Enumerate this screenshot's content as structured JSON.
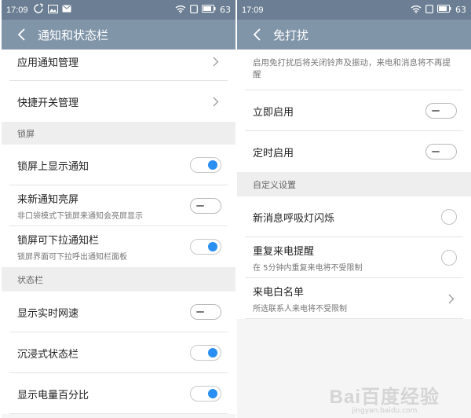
{
  "left": {
    "status_time": "17:09",
    "battery": "63",
    "title": "通知和状态栏",
    "rows_top": [
      {
        "label": "应用通知管理"
      },
      {
        "label": "快捷开关管理"
      }
    ],
    "section_lock": "锁屏",
    "lock_rows": [
      {
        "label": "锁屏上显示通知",
        "sub": "",
        "on": true
      },
      {
        "label": "来新通知亮屏",
        "sub": "非口袋模式下锁屏来通知会亮屏显示",
        "on": false
      },
      {
        "label": "锁屏可下拉通知栏",
        "sub": "锁屏界面可下拉呼出通知栏面板",
        "on": true
      }
    ],
    "section_status": "状态栏",
    "status_rows": [
      {
        "label": "显示实时网速",
        "on": false
      },
      {
        "label": "沉浸式状态栏",
        "on": true
      },
      {
        "label": "显示电量百分比",
        "on": true
      }
    ]
  },
  "right": {
    "status_time": "17:09",
    "battery": "63",
    "title": "免打扰",
    "description": "启用免打扰后将关闭铃声及振动，来电和消息将不再提醒",
    "rows": [
      {
        "label": "立即启用",
        "on": false
      },
      {
        "label": "定时启用",
        "on": false
      }
    ],
    "section_custom": "自定义设置",
    "custom_rows": [
      {
        "label": "新消息呼吸灯闪烁",
        "sub": ""
      },
      {
        "label": "重复来电提醒",
        "sub": "在 5分钟内重复来电将不受限制"
      },
      {
        "label": "来电白名单",
        "sub": "所选联系人来电将不受限制"
      }
    ]
  },
  "watermark": {
    "logo": "Bai百度经验",
    "url": "jingyan.baidu.com"
  },
  "colors": {
    "statusbar": "#6b7e93",
    "titlebar": "#8195a9",
    "toggle_on": "#2a8ef2",
    "section_bg": "#eeeeee"
  }
}
